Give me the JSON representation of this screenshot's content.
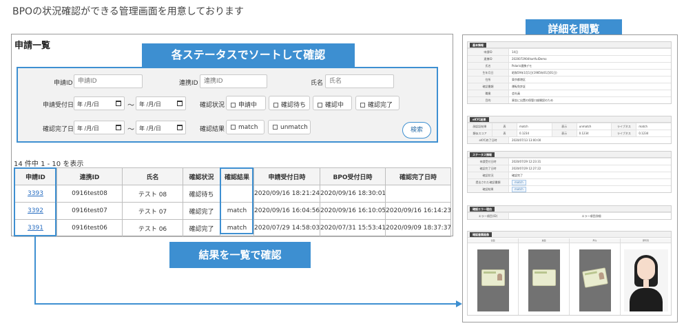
{
  "heading": "BPOの状況確認ができる管理画面を用意しております",
  "list_panel": {
    "title": "申請一覧",
    "filters": {
      "application_id_label": "申請ID",
      "application_id_placeholder": "申請ID",
      "link_id_label": "連携ID",
      "link_id_placeholder": "連携ID",
      "name_label": "氏名",
      "name_placeholder": "氏名",
      "received_date_label": "申請受付日",
      "completed_date_label": "確認完了日",
      "date_placeholder": "年 /月/日",
      "tilde": "～",
      "status_label": "確認状況",
      "status_options": [
        "申請中",
        "確認待ち",
        "確認中",
        "確認完了"
      ],
      "result_label": "確認結果",
      "result_options": [
        "match",
        "unmatch"
      ],
      "search_button": "検索"
    },
    "count_text": "14 件中 1 - 10 を表示",
    "table": {
      "headers": [
        "申請ID",
        "連携ID",
        "氏名",
        "確認状況",
        "確認結果",
        "申請受付日時",
        "BPO受付日時",
        "確認完了日時"
      ],
      "rows": [
        [
          "3393",
          "0916test08",
          "テスト 08",
          "確認待ち",
          "",
          "2020/09/16 18:21:24",
          "2020/09/16 18:30:01",
          ""
        ],
        [
          "3392",
          "0916test07",
          "テスト 07",
          "確認完了",
          "match",
          "2020/09/16 16:04:56",
          "2020/09/16 16:10:05",
          "2020/09/16 16:14:23"
        ],
        [
          "3391",
          "0916test06",
          "テスト 06",
          "確認完了",
          "match",
          "2020/07/29 14:58:03",
          "2020/07/31 15:53:41",
          "2020/09/09 18:37:37"
        ]
      ]
    }
  },
  "callouts": {
    "sort": "各ステータスでソートして確認",
    "list": "結果を一覧で確認",
    "detail": "詳細を閲覧"
  },
  "detail_panel": {
    "basic": {
      "tag": "基本情報",
      "rows": [
        [
          "申請ID",
          "14日"
        ],
        [
          "連携ID",
          "2020072904hartfulDemo"
        ],
        [
          "氏名",
          "Polaris連携デモ"
        ],
        [
          "生年月日",
          "昭和59年1月1日(1985年01月01日)"
        ],
        [
          "住所",
          "東京都港区"
        ],
        [
          "確認書類",
          "運転免許証"
        ],
        [
          "職業",
          "会社員"
        ],
        [
          "目的",
          "資金に出置の保管口座開設のため"
        ]
      ]
    },
    "ekyc": {
      "tag": "eKYC結果",
      "rows": [
        [
          "顔認証結果",
          "表",
          "match",
          "表示",
          "unmatch",
          "ライブネス",
          "match"
        ],
        [
          "類似スコア",
          "表",
          "0.1234",
          "表示",
          "0.1234",
          "ライブネス",
          "0.1234"
        ]
      ],
      "complete_row": [
        "eKYC終了日時",
        "2020/07/13 13:00:00"
      ]
    },
    "status": {
      "tag": "ステータス情報",
      "rows": [
        [
          "申請受付日時",
          "2020/07/29 12:23:31"
        ],
        [
          "確認完了日時",
          "2020/07/29 12:27:22"
        ],
        [
          "確認状況",
          "確認完了"
        ],
        [
          "提出された確認書類",
          "match"
        ],
        [
          "確認結果",
          "match"
        ]
      ]
    },
    "error": {
      "tag": "確認エラー理由",
      "row": [
        "エラー項目(ID)",
        "エラー項目詳細"
      ]
    },
    "images": {
      "tag": "確認書類画像",
      "captions": [
        "表面",
        "裏面",
        "厚み",
        "顔写真"
      ]
    }
  }
}
